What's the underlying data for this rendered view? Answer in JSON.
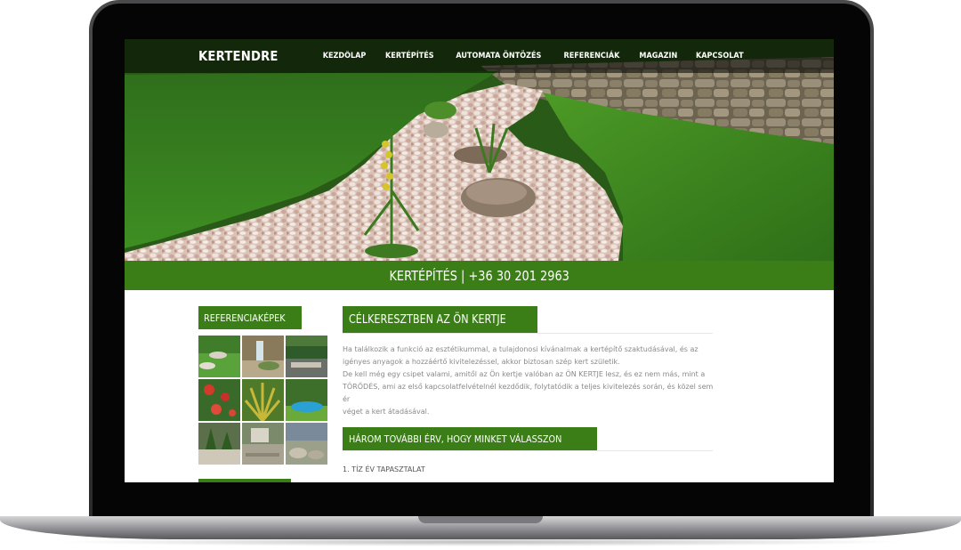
{
  "site": {
    "logo": "KERTENDRE"
  },
  "nav": {
    "items": [
      {
        "label": "KEZDŐLAP"
      },
      {
        "label": "KERTÉPÍTÉS"
      },
      {
        "label": "AUTOMATA ÖNTÖZÉS"
      },
      {
        "label": "REFERENCIÁK"
      },
      {
        "label": "MAGAZIN"
      },
      {
        "label": "KAPCSOLAT"
      }
    ]
  },
  "band": {
    "text": "KERTÉPÍTÉS | +36 30 201 2963"
  },
  "sidebar": {
    "heading": "REFERENCIAKÉPEK",
    "thumb_count": 9
  },
  "main": {
    "heading": "CÉLKERESZTBEN AZ ÖN KERTJE",
    "paragraph_lines": [
      "Ha találkozik a funkció az esztétikummal, a tulajdonosi kívánalmak a kertépítő szaktudásával, és az",
      "igényes anyagok a hozzáértő kivitelezéssel, akkor biztosan szép kert születik.",
      "De kell még egy csipet valami, amitől az Ön kertje valóban az ÖN KERTJE lesz, és ez nem más, mint a",
      "TÖRŐDÉS, ami az első kapcsolatfelvételnél kezdődik, folytatódik a teljes kivitelezés során, és közel sem ér",
      "véget a kert átadásával."
    ],
    "subheading": "HÁROM TOVÁBBI ÉRV, HOGY MINKET VÁLASSZON",
    "list_first": "1. TÍZ ÉV TAPASZTALAT"
  },
  "colors": {
    "brand_green": "#3b7d17",
    "body_text": "#8a8a8a"
  }
}
